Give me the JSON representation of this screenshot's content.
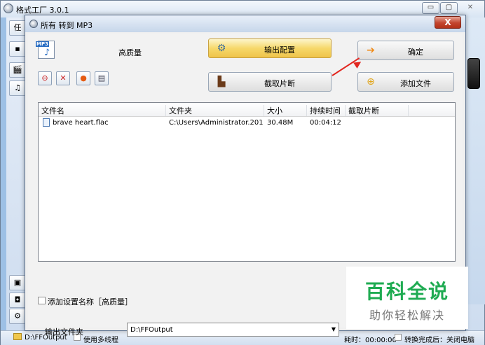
{
  "main_window": {
    "title": "格式工厂 3.0.1",
    "min_label": "▭",
    "max_label": "▢",
    "close_label": "✕",
    "side_tab_label": "任"
  },
  "status_bar": {
    "output_path": "D:\\FFOutput",
    "multithread_label": "使用多线程",
    "elapsed": "耗时：00:00:00",
    "after_convert": "转换完成后：关闭电脑"
  },
  "dialog": {
    "title": "所有 转到 MP3",
    "close_label": "X",
    "quality_label": "高质量",
    "output_config_label": "输出配置",
    "ok_label": "确定",
    "clip_label": "截取片断",
    "add_file_label": "添加文件",
    "add_setting_label": "添加设置名称［高质量］",
    "output_folder_label": "输出文件夹",
    "output_folder_value": "D:\\FFOutput"
  },
  "file_list": {
    "columns": [
      "文件名",
      "文件夹",
      "大小",
      "持续时间",
      "截取片断"
    ],
    "rows": [
      {
        "name": "brave heart.flac",
        "folder": "C:\\Users\\Administrator.201...",
        "size": "30.48M",
        "duration": "00:04:12",
        "clip": ""
      }
    ]
  },
  "watermark": {
    "title": "百科全说",
    "subtitle": "助你轻松解决"
  },
  "icons": {
    "output_config": "gear-icon",
    "ok": "arrow-right-icon",
    "clip": "film-icon",
    "add_file": "add-file-icon"
  }
}
